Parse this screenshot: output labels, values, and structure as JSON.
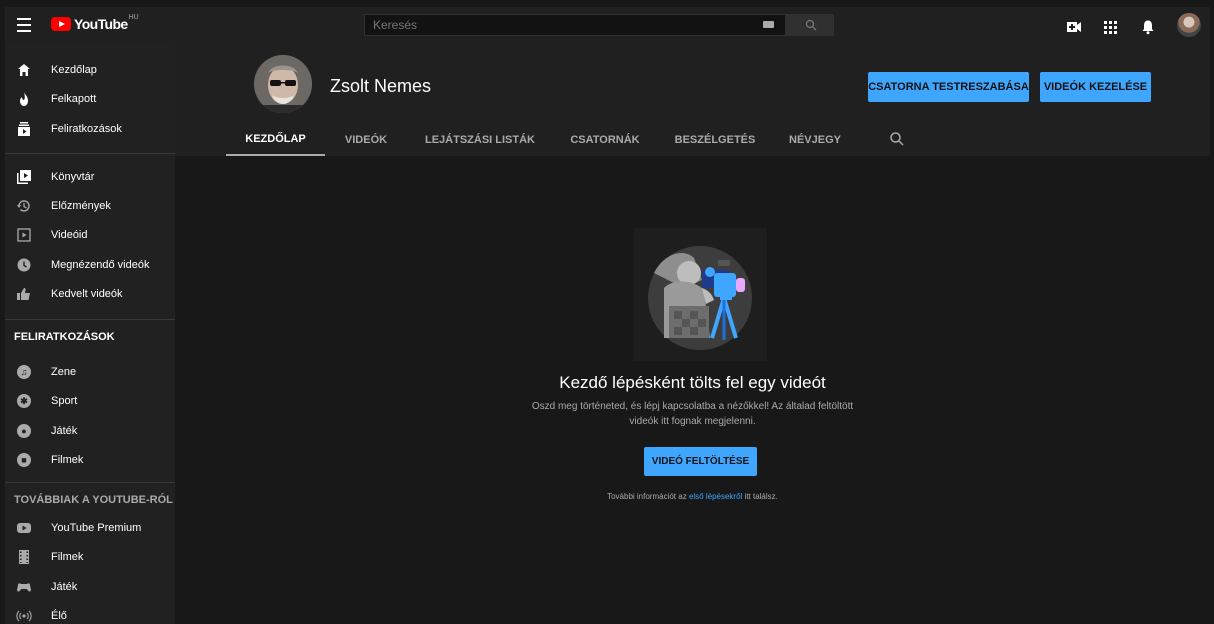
{
  "topbar": {
    "logo_text": "YouTube",
    "logo_country": "HU",
    "search_placeholder": "Keresés"
  },
  "sidebar": {
    "main": [
      {
        "label": "Kezdőlap",
        "icon": "home-icon"
      },
      {
        "label": "Felkapott",
        "icon": "trending-icon"
      },
      {
        "label": "Feliratkozások",
        "icon": "subscriptions-icon"
      }
    ],
    "library": [
      {
        "label": "Könyvtár",
        "icon": "library-icon"
      },
      {
        "label": "Előzmények",
        "icon": "history-icon"
      },
      {
        "label": "Videóid",
        "icon": "your-videos-icon"
      },
      {
        "label": "Megnézendő videók",
        "icon": "watch-later-icon"
      },
      {
        "label": "Kedvelt videók",
        "icon": "liked-icon"
      }
    ],
    "subscriptions_header": "FELIRATKOZÁSOK",
    "subscriptions": [
      {
        "label": "Zene",
        "icon": "music-icon"
      },
      {
        "label": "Sport",
        "icon": "sport-icon"
      },
      {
        "label": "Játék",
        "icon": "gaming-icon"
      },
      {
        "label": "Filmek",
        "icon": "movies-icon"
      }
    ],
    "more_header": "TOVÁBBIAK A YOUTUBE-RÓL",
    "more": [
      {
        "label": "YouTube Premium",
        "icon": "youtube-premium-icon"
      },
      {
        "label": "Filmek",
        "icon": "film-strip-icon"
      },
      {
        "label": "Játék",
        "icon": "gamepad-icon"
      },
      {
        "label": "Élő",
        "icon": "live-icon"
      }
    ]
  },
  "channel": {
    "name": "Zsolt Nemes",
    "customize_label": "CSATORNA TESTRESZABÁSA",
    "manage_label": "VIDEÓK KEZELÉSE",
    "tabs": [
      "KEZDŐLAP",
      "VIDEÓK",
      "LEJÁTSZÁSI LISTÁK",
      "CSATORNÁK",
      "BESZÉLGETÉS",
      "NÉVJEGY"
    ],
    "active_tab": "KEZDŐLAP"
  },
  "empty_state": {
    "title": "Kezdő lépésként tölts fel egy videót",
    "description": "Oszd meg történeted, és lépj kapcsolatba a nézőkkel! Az általad feltöltött videók itt fognak megjelenni.",
    "upload_label": "VIDEÓ FELTÖLTÉSE",
    "more_prefix": "További információt az ",
    "more_link": "első lépésekről",
    "more_suffix": " itt találsz."
  },
  "colors": {
    "accent": "#3ea6ff",
    "logo_red": "#ff0000",
    "background": "#181818",
    "surface": "#202020"
  }
}
